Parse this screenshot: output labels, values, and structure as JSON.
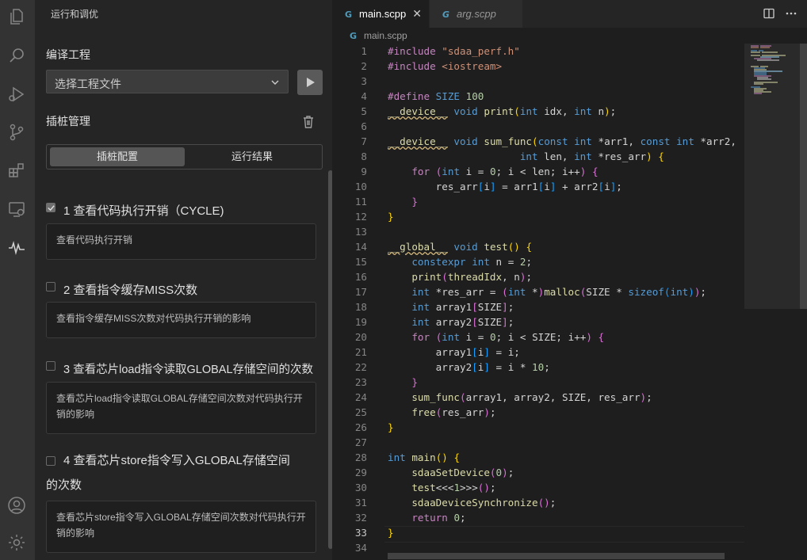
{
  "sidebar": {
    "title": "运行和调优",
    "compile_section": "编译工程",
    "select_placeholder": "选择工程文件",
    "instrument_section": "插桩管理",
    "tabs": [
      "插桩配置",
      "运行结果"
    ],
    "items": [
      {
        "title": "1 查看代码执行开销（CYCLE)",
        "desc": "查看代码执行开销",
        "checked": true
      },
      {
        "title": "2 查看指令缓存MISS次数",
        "desc": "查看指令缓存MISS次数对代码执行开销的影响",
        "checked": false
      },
      {
        "title": "3 查看芯片load指令读取GLOBAL存储空间的次数",
        "desc": "查看芯片load指令读取GLOBAL存储空间次数对代码执行开销的影响",
        "checked": false
      },
      {
        "title": "4 查看芯片store指令写入GLOBAL存储空间的次数",
        "desc": "查看芯片store指令写入GLOBAL存储空间次数对代码执行开销的影响",
        "checked": false
      }
    ]
  },
  "editor": {
    "tabs": [
      {
        "label": "main.scpp",
        "active": true
      },
      {
        "label": "arg.scpp",
        "active": false
      }
    ],
    "breadcrumb": "main.scpp",
    "current_line": 33,
    "line_count": 34
  },
  "colors": {
    "accent": "#007acc",
    "keyword": "#569cd6",
    "function": "#dcdcaa",
    "string": "#ce9178",
    "number": "#b5cea8",
    "variable": "#9cdcfe",
    "control": "#c586c0"
  },
  "icons": [
    "explorer-icon",
    "search-icon",
    "run-debug-icon",
    "source-control-icon",
    "extensions-icon",
    "remote-explorer-icon",
    "profiler-icon",
    "account-icon",
    "settings-gear-icon"
  ]
}
